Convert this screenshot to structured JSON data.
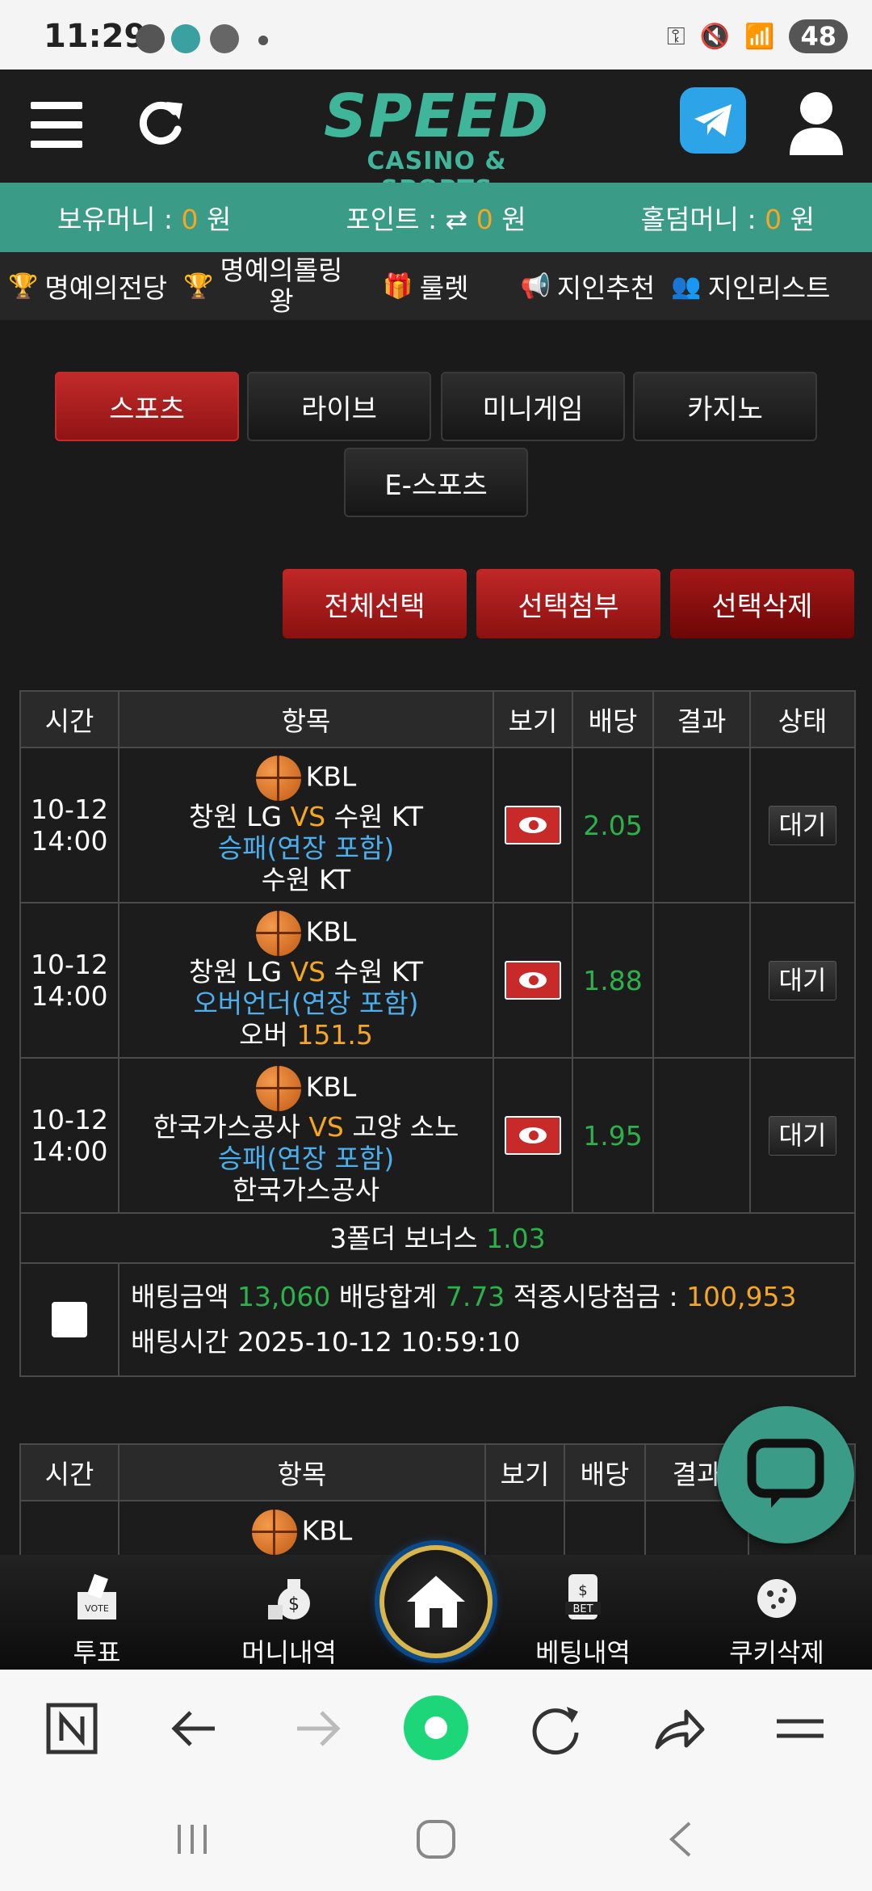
{
  "status": {
    "time": "11:29",
    "battery": "48"
  },
  "header": {
    "logo_main": "SPEED",
    "logo_sub": "CASINO & SPORTS"
  },
  "balance": [
    {
      "label": "보유머니 : ",
      "value": "0",
      "unit": " 원"
    },
    {
      "label": "포인트 : ⇄ ",
      "value": "0",
      "unit": " 원"
    },
    {
      "label": "홀덤머니 : ",
      "value": "0",
      "unit": " 원"
    }
  ],
  "menu": {
    "hall_of_fame": "명예의전당",
    "rolling_line1": "명예의롤링",
    "rolling_line2": "왕",
    "roulette": "룰렛",
    "referral": "지인추천",
    "referral_list": "지인리스트"
  },
  "categories": [
    "스포츠",
    "라이브",
    "미니게임",
    "카지노",
    "E-스포츠"
  ],
  "actions": {
    "select_all": "전체선택",
    "attach": "선택첨부",
    "delete": "선택삭제"
  },
  "table": {
    "headers": [
      "시간",
      "항목",
      "보기",
      "배당",
      "결과",
      "상태"
    ],
    "rows": [
      {
        "date": "10-12",
        "time": "14:00",
        "league": "KBL",
        "home": "창원 LG",
        "vs": "VS",
        "away": "수원 KT",
        "market": "승패(연장 포함)",
        "pick": "수원 KT",
        "pick_extra": "",
        "odds": "2.05",
        "status": "대기"
      },
      {
        "date": "10-12",
        "time": "14:00",
        "league": "KBL",
        "home": "창원 LG",
        "vs": "VS",
        "away": "수원 KT",
        "market": "오버언더(연장 포함)",
        "pick": "오버",
        "pick_extra": "151.5",
        "odds": "1.88",
        "status": "대기"
      },
      {
        "date": "10-12",
        "time": "14:00",
        "league": "KBL",
        "home": "한국가스공사",
        "vs": "VS",
        "away": "고양 소노",
        "market": "승패(연장 포함)",
        "pick": "한국가스공사",
        "pick_extra": "",
        "odds": "1.95",
        "status": "대기"
      }
    ],
    "bonus_label": "3폴더 보너스 ",
    "bonus_value": "1.03",
    "summary": {
      "bet_amount_label": "배팅금액 ",
      "bet_amount": "13,060",
      "odds_total_label": " 배당합계 ",
      "odds_total": "7.73",
      "payout_label": " 적중시당첨금 : ",
      "payout": "100,953",
      "bet_time_label": "배팅시간 ",
      "bet_time": "2025-10-12 10:59:10"
    }
  },
  "table2": {
    "headers": [
      "시간",
      "항목",
      "보기",
      "배당",
      "결과",
      ""
    ],
    "league": "KBL"
  },
  "bottom_nav": [
    "투표",
    "머니내역",
    "베팅내역",
    "쿠키삭제"
  ],
  "colors": {
    "accent": "#3a9b87",
    "red": "#c32a2a",
    "orange": "#f5a623",
    "green": "#2bb24a",
    "blue": "#4ab0ef"
  }
}
